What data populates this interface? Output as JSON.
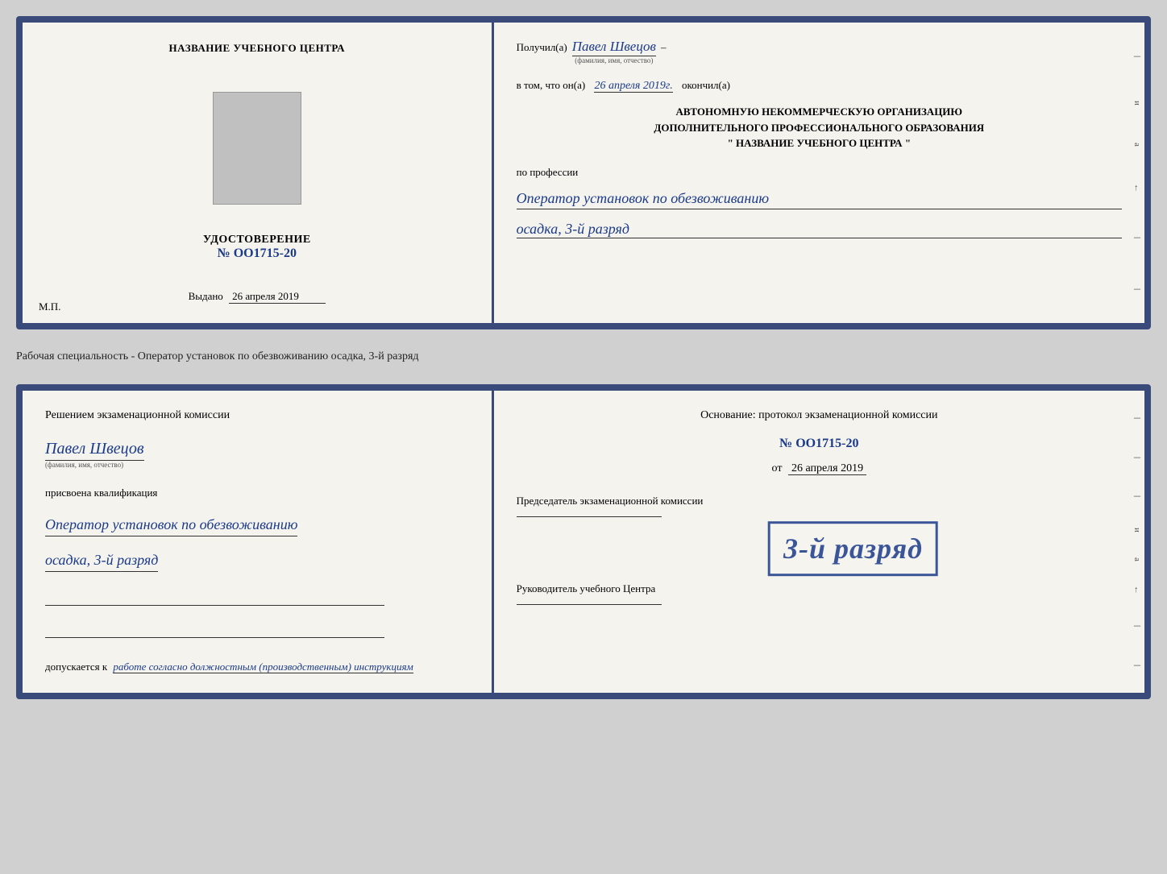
{
  "topDoc": {
    "left": {
      "trainingCenterLabel": "НАЗВАНИЕ УЧЕБНОГО ЦЕНТРА",
      "udostoverenie": "УДОСТОВЕРЕНИЕ",
      "certNumber": "№ OO1715-20",
      "vydanoLabel": "Выдано",
      "vydanoDate": "26 апреля 2019",
      "mpLabel": "М.П."
    },
    "right": {
      "poluchilLabel": "Получил(а)",
      "recipientName": "Павел Швецов",
      "fioSubLabel": "(фамилия, имя, отчество)",
      "dash": "–",
      "vtomLabel": "в том, что он(а)",
      "vtomDate": "26 апреля 2019г.",
      "okonchilLabel": "окончил(а)",
      "orgLine1": "АВТОНОМНУЮ НЕКОММЕРЧЕСКУЮ ОРГАНИЗАЦИЮ",
      "orgLine2": "ДОПОЛНИТЕЛЬНОГО ПРОФЕССИОНАЛЬНОГО ОБРАЗОВАНИЯ",
      "orgLine3": "\"   НАЗВАНИЕ УЧЕБНОГО ЦЕНТРА   \"",
      "poLabel": "по профессии",
      "profession": "Оператор установок по обезвоживанию",
      "razryad": "осадка, 3-й разряд"
    }
  },
  "separatorText": "Рабочая специальность - Оператор установок по обезвоживанию осадка, 3-й разряд",
  "bottomDoc": {
    "left": {
      "resheniyem": "Решением экзаменационной комиссии",
      "personName": "Павел Швецов",
      "personSubLabel": "(фамилия, имя, отчество)",
      "prisvoena": "присвоена квалификация",
      "qual1": "Оператор установок по обезвоживанию",
      "qual2": "осадка, 3-й разряд",
      "dopuskaetsyaLabel": "допускается к",
      "dopuskaetsyaText": "работе согласно должностным (производственным) инструкциям"
    },
    "right": {
      "osnovanie": "Основание: протокол экзаменационной комиссии",
      "protocolNumber": "№ OO1715-20",
      "otLabel": "от",
      "otDate": "26 апреля 2019",
      "predsedatelLabel": "Председатель экзаменационной комиссии",
      "rukovoditelLabel": "Руководитель учебного Центра"
    },
    "stamp": {
      "text": "3-й разряд"
    }
  },
  "sideLetters": {
    "top": [
      "и",
      "а",
      "←",
      "–"
    ],
    "bottom": [
      "и",
      "а",
      "←",
      "–"
    ]
  }
}
